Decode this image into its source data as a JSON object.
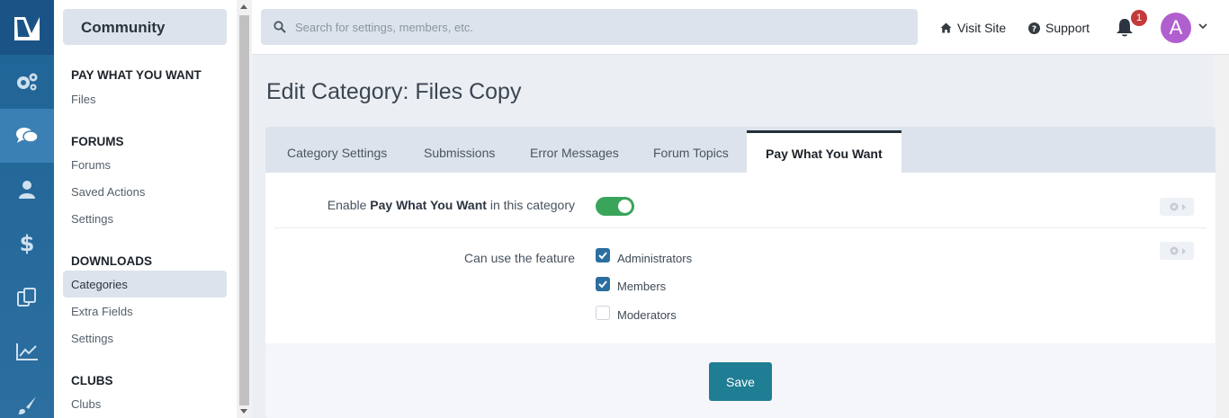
{
  "rail": {
    "items": [
      {
        "icon": "gears-icon",
        "active": false
      },
      {
        "icon": "comments-icon",
        "active": true
      },
      {
        "icon": "user-icon",
        "active": false
      },
      {
        "icon": "dollar-icon",
        "active": false
      },
      {
        "icon": "copy-icon",
        "active": false
      },
      {
        "icon": "line-chart-icon",
        "active": false
      },
      {
        "icon": "paintbrush-icon",
        "active": false
      }
    ]
  },
  "subnav": {
    "header": "Community",
    "sections": [
      {
        "title": "PAY WHAT YOU WANT",
        "items": [
          "Files"
        ]
      },
      {
        "title": "FORUMS",
        "items": [
          "Forums",
          "Saved Actions",
          "Settings"
        ]
      },
      {
        "title": "DOWNLOADS",
        "items": [
          "Categories",
          "Extra Fields",
          "Settings"
        ]
      },
      {
        "title": "CLUBS",
        "items": [
          "Clubs"
        ]
      }
    ],
    "selected_item": "Categories"
  },
  "header": {
    "search_placeholder": "Search for settings, members, etc.",
    "visit_site": "Visit Site",
    "support": "Support",
    "notification_count": "1",
    "avatar_letter": "A"
  },
  "page": {
    "title": "Edit Category: Files Copy"
  },
  "tabs": [
    {
      "label": "Category Settings",
      "active": false
    },
    {
      "label": "Submissions",
      "active": false
    },
    {
      "label": "Error Messages",
      "active": false
    },
    {
      "label": "Forum Topics",
      "active": false
    },
    {
      "label": "Pay What You Want",
      "active": true
    }
  ],
  "form": {
    "enable_prefix": "Enable ",
    "enable_bold": "Pay What You Want",
    "enable_suffix": " in this category",
    "enable_on": true,
    "feature_label": "Can use the feature",
    "groups": [
      {
        "label": "Administrators",
        "checked": true
      },
      {
        "label": "Members",
        "checked": true
      },
      {
        "label": "Moderators",
        "checked": false
      }
    ],
    "save_label": "Save"
  },
  "colors": {
    "accent": "#2c6ea0",
    "toggle_on": "#3aa45b",
    "save_button": "#1f7d94",
    "badge": "#c33a3a",
    "avatar": "#b15fcf"
  }
}
